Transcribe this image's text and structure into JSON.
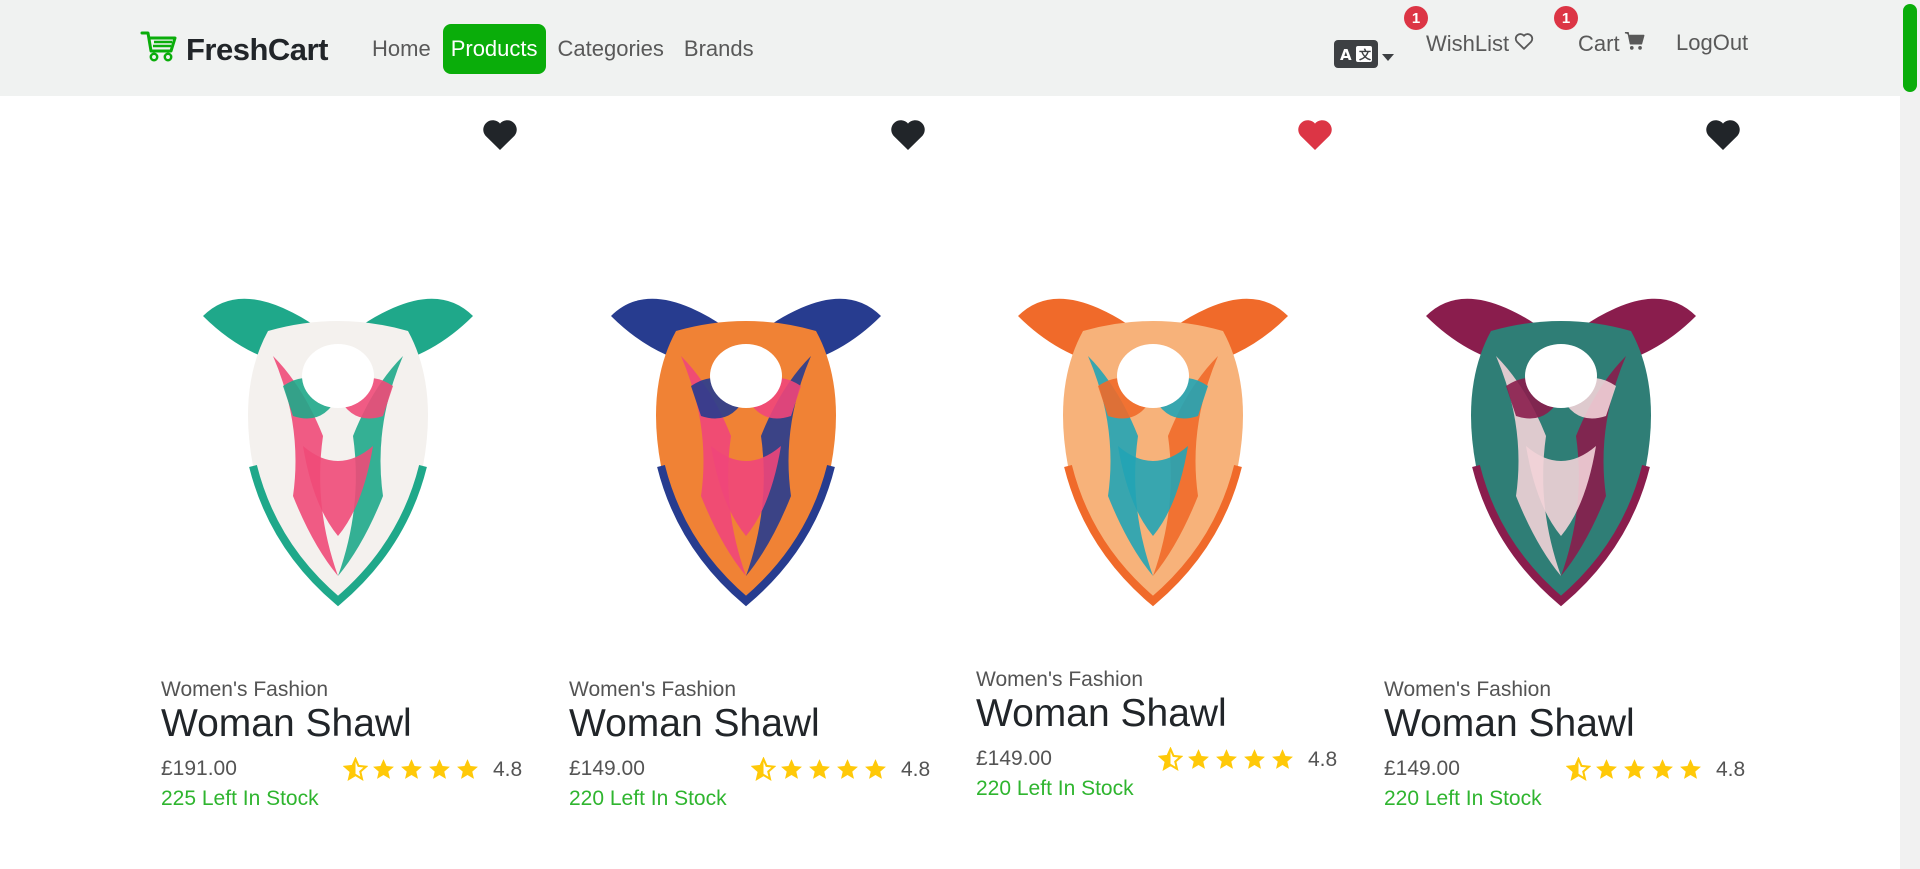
{
  "navbar": {
    "brand": "FreshCart",
    "links": [
      "Home",
      "Products",
      "Categories",
      "Brands"
    ],
    "active_link": "Products",
    "language_icon": "translate-icon",
    "wishlist_label": "WishList",
    "wishlist_count": "1",
    "cart_label": "Cart",
    "cart_count": "1",
    "logout_label": "LogOut"
  },
  "colors": {
    "brand_green": "#0aad0a",
    "nav_bg": "#f0f2f1",
    "stock_green": "#2fb52f",
    "heart_active": "#dc3545",
    "heart_default": "#212529",
    "star": "#ffc908",
    "badge": "#dc3545"
  },
  "products": [
    {
      "category": "Women's Fashion",
      "title": "Woman Shawl",
      "price": "£191.00",
      "rating": "4.8",
      "stock": "225 Left In Stock",
      "wishlisted": false,
      "scarf_colors": [
        "#1fa88a",
        "#f04a78",
        "#f4f1ee"
      ]
    },
    {
      "category": "Women's Fashion",
      "title": "Woman Shawl",
      "price": "£149.00",
      "rating": "4.8",
      "stock": "220 Left In Stock",
      "wishlisted": false,
      "scarf_colors": [
        "#273c8f",
        "#f0467a",
        "#f08235"
      ]
    },
    {
      "category": "Women's Fashion",
      "title": "Woman Shawl",
      "price": "£149.00",
      "rating": "4.8",
      "stock": "220 Left In Stock",
      "wishlisted": true,
      "scarf_colors": [
        "#f06a2a",
        "#22a4b5",
        "#f7b27a"
      ]
    },
    {
      "category": "Women's Fashion",
      "title": "Woman Shawl",
      "price": "£149.00",
      "rating": "4.8",
      "stock": "220 Left In Stock",
      "wishlisted": false,
      "scarf_colors": [
        "#8a1d4d",
        "#f2d3d8",
        "#2f7e76"
      ]
    }
  ]
}
